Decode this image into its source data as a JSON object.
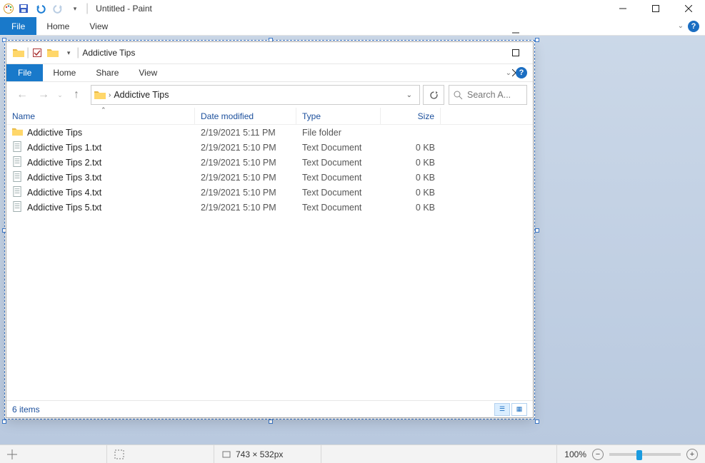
{
  "paint": {
    "title": "Untitled - Paint",
    "menu": {
      "file": "File",
      "home": "Home",
      "view": "View"
    },
    "status": {
      "canvas_size": "743 × 532px",
      "zoom": "100%"
    }
  },
  "explorer": {
    "title": "Addictive Tips",
    "menu": {
      "file": "File",
      "home": "Home",
      "share": "Share",
      "view": "View"
    },
    "breadcrumb": [
      "Addictive Tips"
    ],
    "search_placeholder": "Search A...",
    "columns": {
      "name": "Name",
      "date": "Date modified",
      "type": "Type",
      "size": "Size"
    },
    "rows": [
      {
        "icon": "folder",
        "name": "Addictive Tips",
        "date": "2/19/2021 5:11 PM",
        "type": "File folder",
        "size": ""
      },
      {
        "icon": "file",
        "name": "Addictive Tips 1.txt",
        "date": "2/19/2021 5:10 PM",
        "type": "Text Document",
        "size": "0 KB"
      },
      {
        "icon": "file",
        "name": "Addictive Tips 2.txt",
        "date": "2/19/2021 5:10 PM",
        "type": "Text Document",
        "size": "0 KB"
      },
      {
        "icon": "file",
        "name": "Addictive Tips 3.txt",
        "date": "2/19/2021 5:10 PM",
        "type": "Text Document",
        "size": "0 KB"
      },
      {
        "icon": "file",
        "name": "Addictive Tips 4.txt",
        "date": "2/19/2021 5:10 PM",
        "type": "Text Document",
        "size": "0 KB"
      },
      {
        "icon": "file",
        "name": "Addictive Tips 5.txt",
        "date": "2/19/2021 5:10 PM",
        "type": "Text Document",
        "size": "0 KB"
      }
    ],
    "status": "6 items"
  }
}
